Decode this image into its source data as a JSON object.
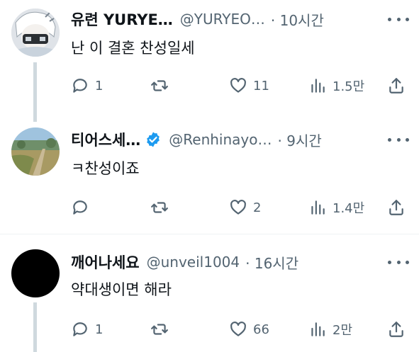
{
  "tweets": [
    {
      "name": "유련 YURYE…",
      "handle": "@YURYEO…",
      "time": "· 10시간",
      "text": "난 이 결혼 찬성일세",
      "replies": "1",
      "retweets": "",
      "likes": "11",
      "views": "1.5만",
      "verified": false
    },
    {
      "name": "티어스세…",
      "handle": "@Renhinayo…",
      "time": "· 9시간",
      "text": "ㅋ찬성이죠",
      "replies": "",
      "retweets": "",
      "likes": "2",
      "views": "1.4만",
      "verified": true
    },
    {
      "name": "깨어나세요",
      "handle": "@unveil1004",
      "time": "· 16시간",
      "text": "약대생이면 해라",
      "replies": "1",
      "retweets": "",
      "likes": "66",
      "views": "2만",
      "verified": false
    }
  ],
  "colors": {
    "text_primary": "#0f1419",
    "text_secondary": "#536471",
    "verified_blue": "#1d9bf0",
    "thread_line": "#cfd9de",
    "divider": "#eff3f4"
  },
  "icons": [
    "reply-icon",
    "retweet-icon",
    "like-icon",
    "views-icon",
    "share-icon",
    "more-icon",
    "verified-badge-icon"
  ]
}
